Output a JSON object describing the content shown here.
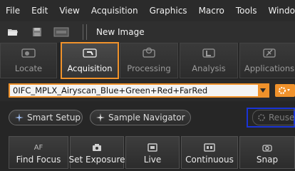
{
  "menu": [
    "File",
    "Edit",
    "View",
    "Acquisition",
    "Graphics",
    "Macro",
    "Tools",
    "Windo"
  ],
  "toolbar": {
    "document_title": "New Image"
  },
  "tabs": [
    {
      "label": "Locate",
      "icon": "eye-icon"
    },
    {
      "label": "Acquisition",
      "icon": "microscope-icon",
      "active": true
    },
    {
      "label": "Processing",
      "icon": "process-gears-icon"
    },
    {
      "label": "Analysis",
      "icon": "analysis-icon"
    },
    {
      "label": "Applications",
      "icon": "applications-icon"
    }
  ],
  "experiment": {
    "selected": "0IFC_MPLX_Airyscan_Blue+Green+Red+FarRed"
  },
  "setup": {
    "smart_setup": "Smart Setup",
    "sample_navigator": "Sample Navigator",
    "reuse": "Reuse"
  },
  "actions": [
    {
      "label": "Find Focus",
      "icon_text": "AF"
    },
    {
      "label": "Set Exposure",
      "icon": "camera-icon"
    },
    {
      "label": "Live",
      "icon": "live-icon"
    },
    {
      "label": "Continuous",
      "icon": "continuous-icon"
    },
    {
      "label": "Snap",
      "icon": "snap-camera-icon"
    }
  ],
  "colors": {
    "accent": "#f0922b",
    "highlight_blue": "#1a34d6",
    "background": "#262626"
  }
}
